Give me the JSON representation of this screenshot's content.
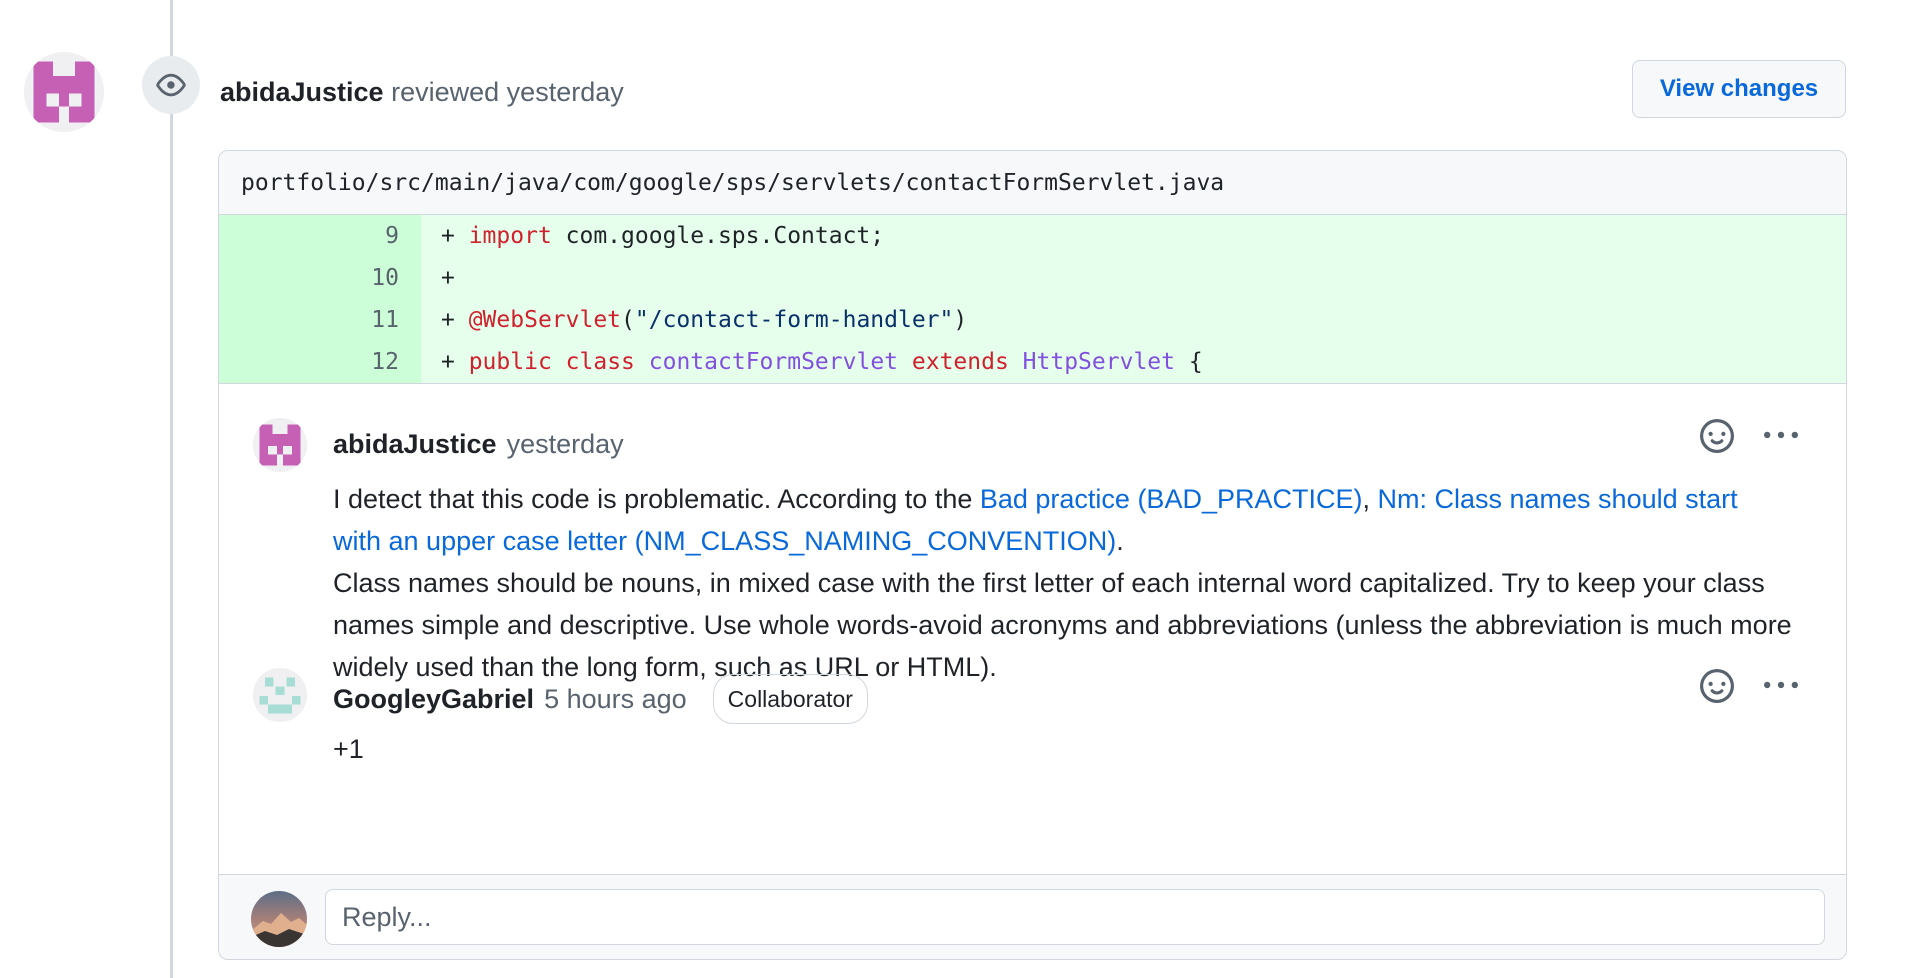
{
  "review": {
    "author": "abidaJustice",
    "action": "reviewed",
    "time": "yesterday",
    "view_changes_label": "View changes"
  },
  "file": {
    "path": "portfolio/src/main/java/com/google/sps/servlets/contactFormServlet.java"
  },
  "diff": {
    "lines": [
      {
        "num": "9",
        "prefix": "+ ",
        "tokens": [
          {
            "t": "import",
            "c": "kw"
          },
          {
            "t": " com.google.sps.Contact;",
            "c": ""
          }
        ]
      },
      {
        "num": "10",
        "prefix": "+ ",
        "tokens": []
      },
      {
        "num": "11",
        "prefix": "+ ",
        "tokens": [
          {
            "t": "@WebServlet",
            "c": "kw"
          },
          {
            "t": "(",
            "c": ""
          },
          {
            "t": "\"/contact-form-handler\"",
            "c": "str"
          },
          {
            "t": ")",
            "c": ""
          }
        ]
      },
      {
        "num": "12",
        "prefix": "+ ",
        "tokens": [
          {
            "t": "public",
            "c": "kw"
          },
          {
            "t": " ",
            "c": ""
          },
          {
            "t": "class",
            "c": "kw"
          },
          {
            "t": " ",
            "c": ""
          },
          {
            "t": "contactFormServlet",
            "c": "cls"
          },
          {
            "t": " ",
            "c": ""
          },
          {
            "t": "extends",
            "c": "kw"
          },
          {
            "t": " ",
            "c": ""
          },
          {
            "t": "HttpServlet",
            "c": "cls"
          },
          {
            "t": " {",
            "c": ""
          }
        ]
      }
    ]
  },
  "comments": [
    {
      "author": "abidaJustice",
      "time": "yesterday",
      "body_intro": "I detect that this code is problematic. According to the ",
      "link1": "Bad practice (BAD_PRACTICE)",
      "separator": ", ",
      "link2": "Nm: Class names should start with an upper case letter (NM_CLASS_NAMING_CONVENTION)",
      "period": ".",
      "body_detail": "Class names should be nouns, in mixed case with the first letter of each internal word capitalized. Try to keep your class names simple and descriptive. Use whole words-avoid acronyms and abbreviations (unless the abbreviation is much more widely used than the long form, such as URL or HTML)."
    },
    {
      "author": "GoogleyGabriel",
      "time": "5 hours ago",
      "badge": "Collaborator",
      "body": "+1"
    }
  ],
  "reply": {
    "placeholder": "Reply..."
  },
  "colors": {
    "link": "#0969da",
    "addition_bg": "#e6ffec",
    "addition_num_bg": "#ccffd8",
    "keyword": "#cf222e",
    "string": "#0a3069",
    "class_name": "#8250df"
  }
}
